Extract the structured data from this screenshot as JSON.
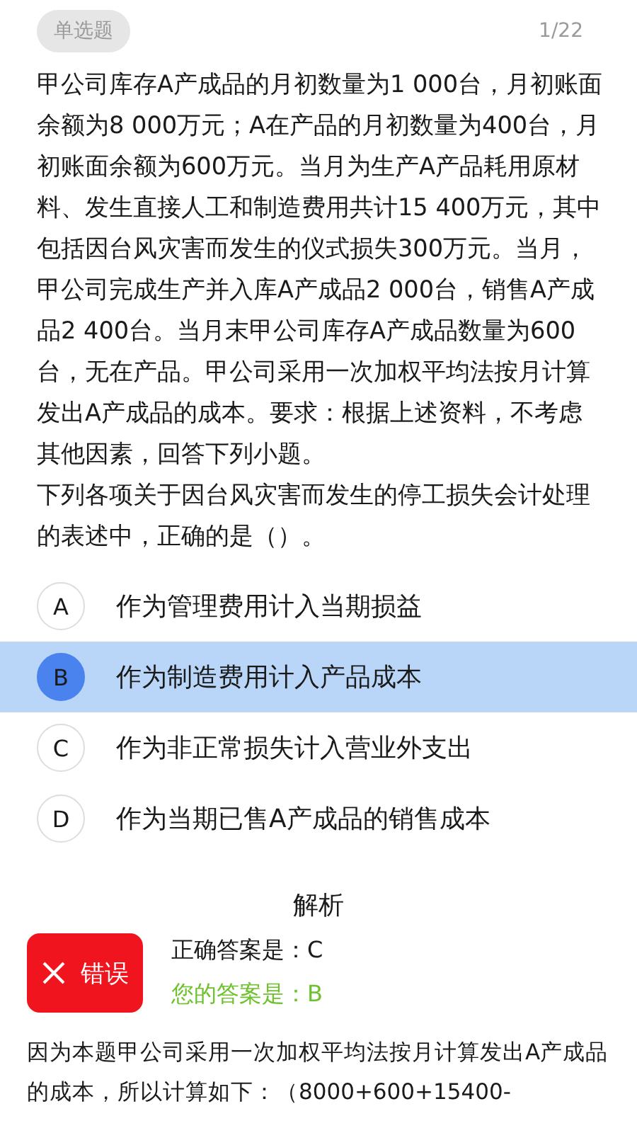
{
  "header": {
    "type_tag": "单选题",
    "counter": "1/22"
  },
  "question": {
    "stem": "甲公司库存A产成品的月初数量为1 000台，月初账面余额为8 000万元；A在产品的月初数量为400台，月初账面余额为600万元。当月为生产A产品耗用原材料、发生直接人工和制造费用共计15 400万元，其中包括因台风灾害而发生的仪式损失300万元。当月，甲公司完成生产并入库A产成品2 000台，销售A产成品2 400台。当月末甲公司库存A产成品数量为600台，无在产品。甲公司采用一次加权平均法按月计算发出A产成品的成本。要求：根据上述资料，不考虑其他因素，回答下列小题。",
    "prompt": "下列各项关于因台风灾害而发生的停工损失会计处理的表述中，正确的是（）。"
  },
  "options": [
    {
      "letter": "A",
      "text": "作为管理费用计入当期损益",
      "selected": false
    },
    {
      "letter": "B",
      "text": "作为制造费用计入产品成本",
      "selected": true
    },
    {
      "letter": "C",
      "text": "作为非正常损失计入营业外支出",
      "selected": false
    },
    {
      "letter": "D",
      "text": "作为当期已售A产成品的销售成本",
      "selected": false
    }
  ],
  "analysis": {
    "title": "解析",
    "result": {
      "kind": "wrong",
      "label": "错误"
    },
    "correct_answer": "正确答案是：C",
    "your_answer": "您的答案是：B",
    "explanation": "因为本题甲公司采用一次加权平均法按月计算发出A产成品的成本，所以计算如下：（8000+600+15400-"
  }
}
